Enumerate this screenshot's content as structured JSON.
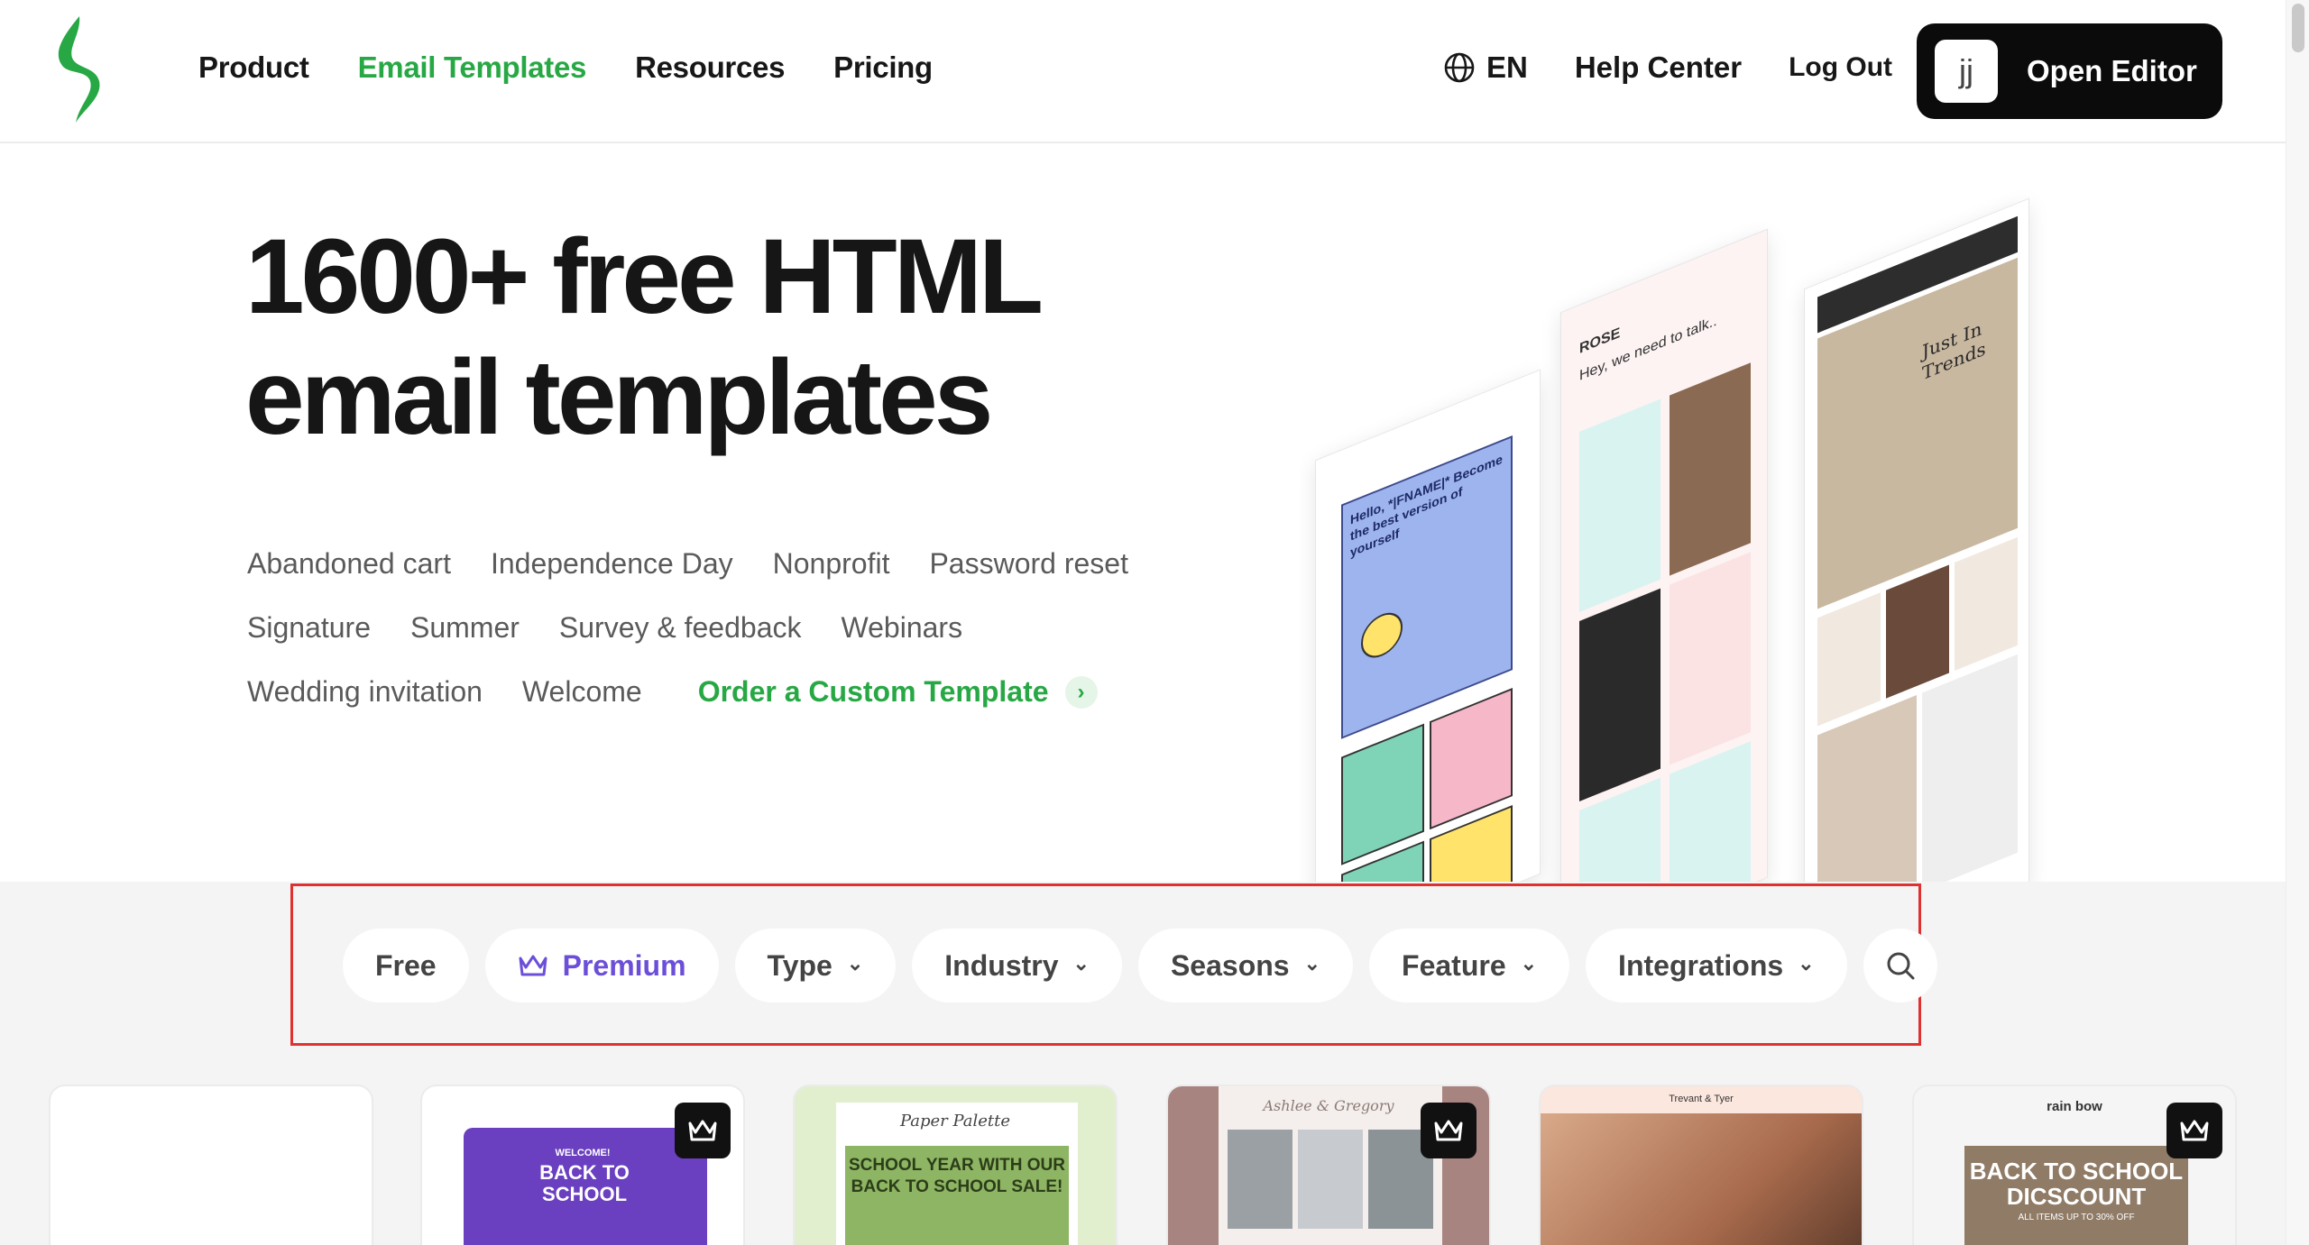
{
  "header": {
    "logo": "stripo-logo-icon",
    "nav": [
      "Product",
      "Email Templates",
      "Resources",
      "Pricing"
    ],
    "active_nav": "Email Templates",
    "language": "EN",
    "help": "Help Center",
    "logout": "Log Out",
    "avatar_initials": "jj",
    "open_editor": "Open Editor"
  },
  "hero": {
    "title_line1": "1600+ free HTML",
    "title_line2": "email templates",
    "tags_row1": [
      "Abandoned cart",
      "Independence Day",
      "Nonprofit",
      "Password reset"
    ],
    "tags_row2": [
      "Signature",
      "Summer",
      "Survey & feedback",
      "Webinars"
    ],
    "tags_row3": [
      "Wedding invitation",
      "Welcome"
    ],
    "custom_template": "Order a Custom Template"
  },
  "illustration": {
    "mock1_text": "Hello, *|FNAME|* Become the best version of yourself",
    "mock2_brand": "ROSE",
    "mock2_text": "Hey, we need to talk..",
    "mock3_text": "Just In Trends"
  },
  "filters": {
    "free": "Free",
    "premium": "Premium",
    "type": "Type",
    "industry": "Industry",
    "seasons": "Seasons",
    "feature": "Feature",
    "integrations": "Integrations"
  },
  "cards": {
    "card2_title": "BACK TO SCHOOL",
    "card2_sub": "WELCOME!",
    "card3_brand": "Paper Palette",
    "card3_title": "SCHOOL YEAR WITH OUR BACK TO SCHOOL SALE!",
    "card4_names": "Ashlee & Gregory",
    "card5_names": "Trevant & Tyer",
    "card6_brand": "rain bow",
    "card6_title": "BACK TO SCHOOL DICSCOUNT",
    "card6_sub": "ALL ITEMS UP TO 30% OFF"
  },
  "colors": {
    "accent_green": "#27a844",
    "premium_purple": "#6b4fd8",
    "highlight_red": "#e03131"
  }
}
